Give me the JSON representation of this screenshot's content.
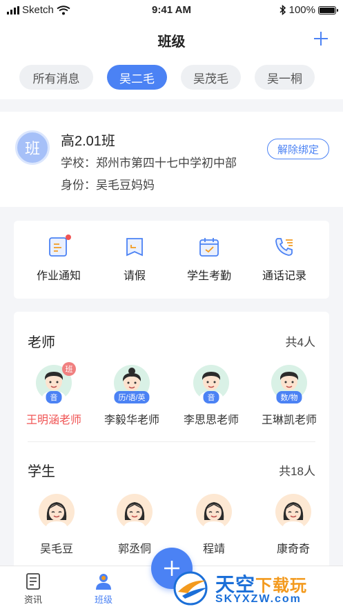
{
  "status_bar": {
    "carrier": "Sketch",
    "time": "9:41 AM",
    "battery": "100%"
  },
  "nav": {
    "title": "班级",
    "add_icon": "plus-icon"
  },
  "tabs": [
    {
      "label": "所有消息",
      "active": false
    },
    {
      "label": "吴二毛",
      "active": true
    },
    {
      "label": "吴茂毛",
      "active": false
    },
    {
      "label": "吴一桐",
      "active": false
    }
  ],
  "class_card": {
    "avatar_text": "班",
    "name": "高2.01班",
    "school": "学校：郑州市第四十七中学初中部",
    "identity": "身份：吴毛豆妈妈",
    "unbind_label": "解除绑定"
  },
  "functions": [
    {
      "label": "作业通知",
      "icon": "homework-icon",
      "badge": true
    },
    {
      "label": "请假",
      "icon": "leave-icon",
      "badge": false
    },
    {
      "label": "学生考勤",
      "icon": "attendance-icon",
      "badge": false
    },
    {
      "label": "通话记录",
      "icon": "call-log-icon",
      "badge": false
    }
  ],
  "teachers": {
    "title": "老师",
    "count": "共4人",
    "items": [
      {
        "name": "王明涵老师",
        "subject": "音",
        "head_teacher": "班",
        "highlight": true,
        "gender": "male"
      },
      {
        "name": "李毅华老师",
        "subject": "历/语/英",
        "head_teacher": "",
        "highlight": false,
        "gender": "female"
      },
      {
        "name": "李思思老师",
        "subject": "音",
        "head_teacher": "",
        "highlight": false,
        "gender": "male"
      },
      {
        "name": "王琳凯老师",
        "subject": "数/物",
        "head_teacher": "",
        "highlight": false,
        "gender": "male"
      }
    ]
  },
  "students": {
    "title": "学生",
    "count": "共18人",
    "items": [
      {
        "name": "吴毛豆"
      },
      {
        "name": "郭丞侗"
      },
      {
        "name": "程靖"
      },
      {
        "name": "康奇奇"
      }
    ]
  },
  "tabbar": {
    "items": [
      {
        "label": "资讯",
        "icon": "news-icon",
        "active": false
      },
      {
        "label": "班级",
        "icon": "class-icon",
        "active": true
      }
    ],
    "fab_icon": "plus-icon"
  },
  "watermark": {
    "title_main": "天空",
    "title_sub": "下载玩",
    "url": "SKYXZW.com"
  },
  "colors": {
    "accent": "#4b82f4",
    "highlight": "#f05454",
    "background": "#f4f5f8"
  }
}
